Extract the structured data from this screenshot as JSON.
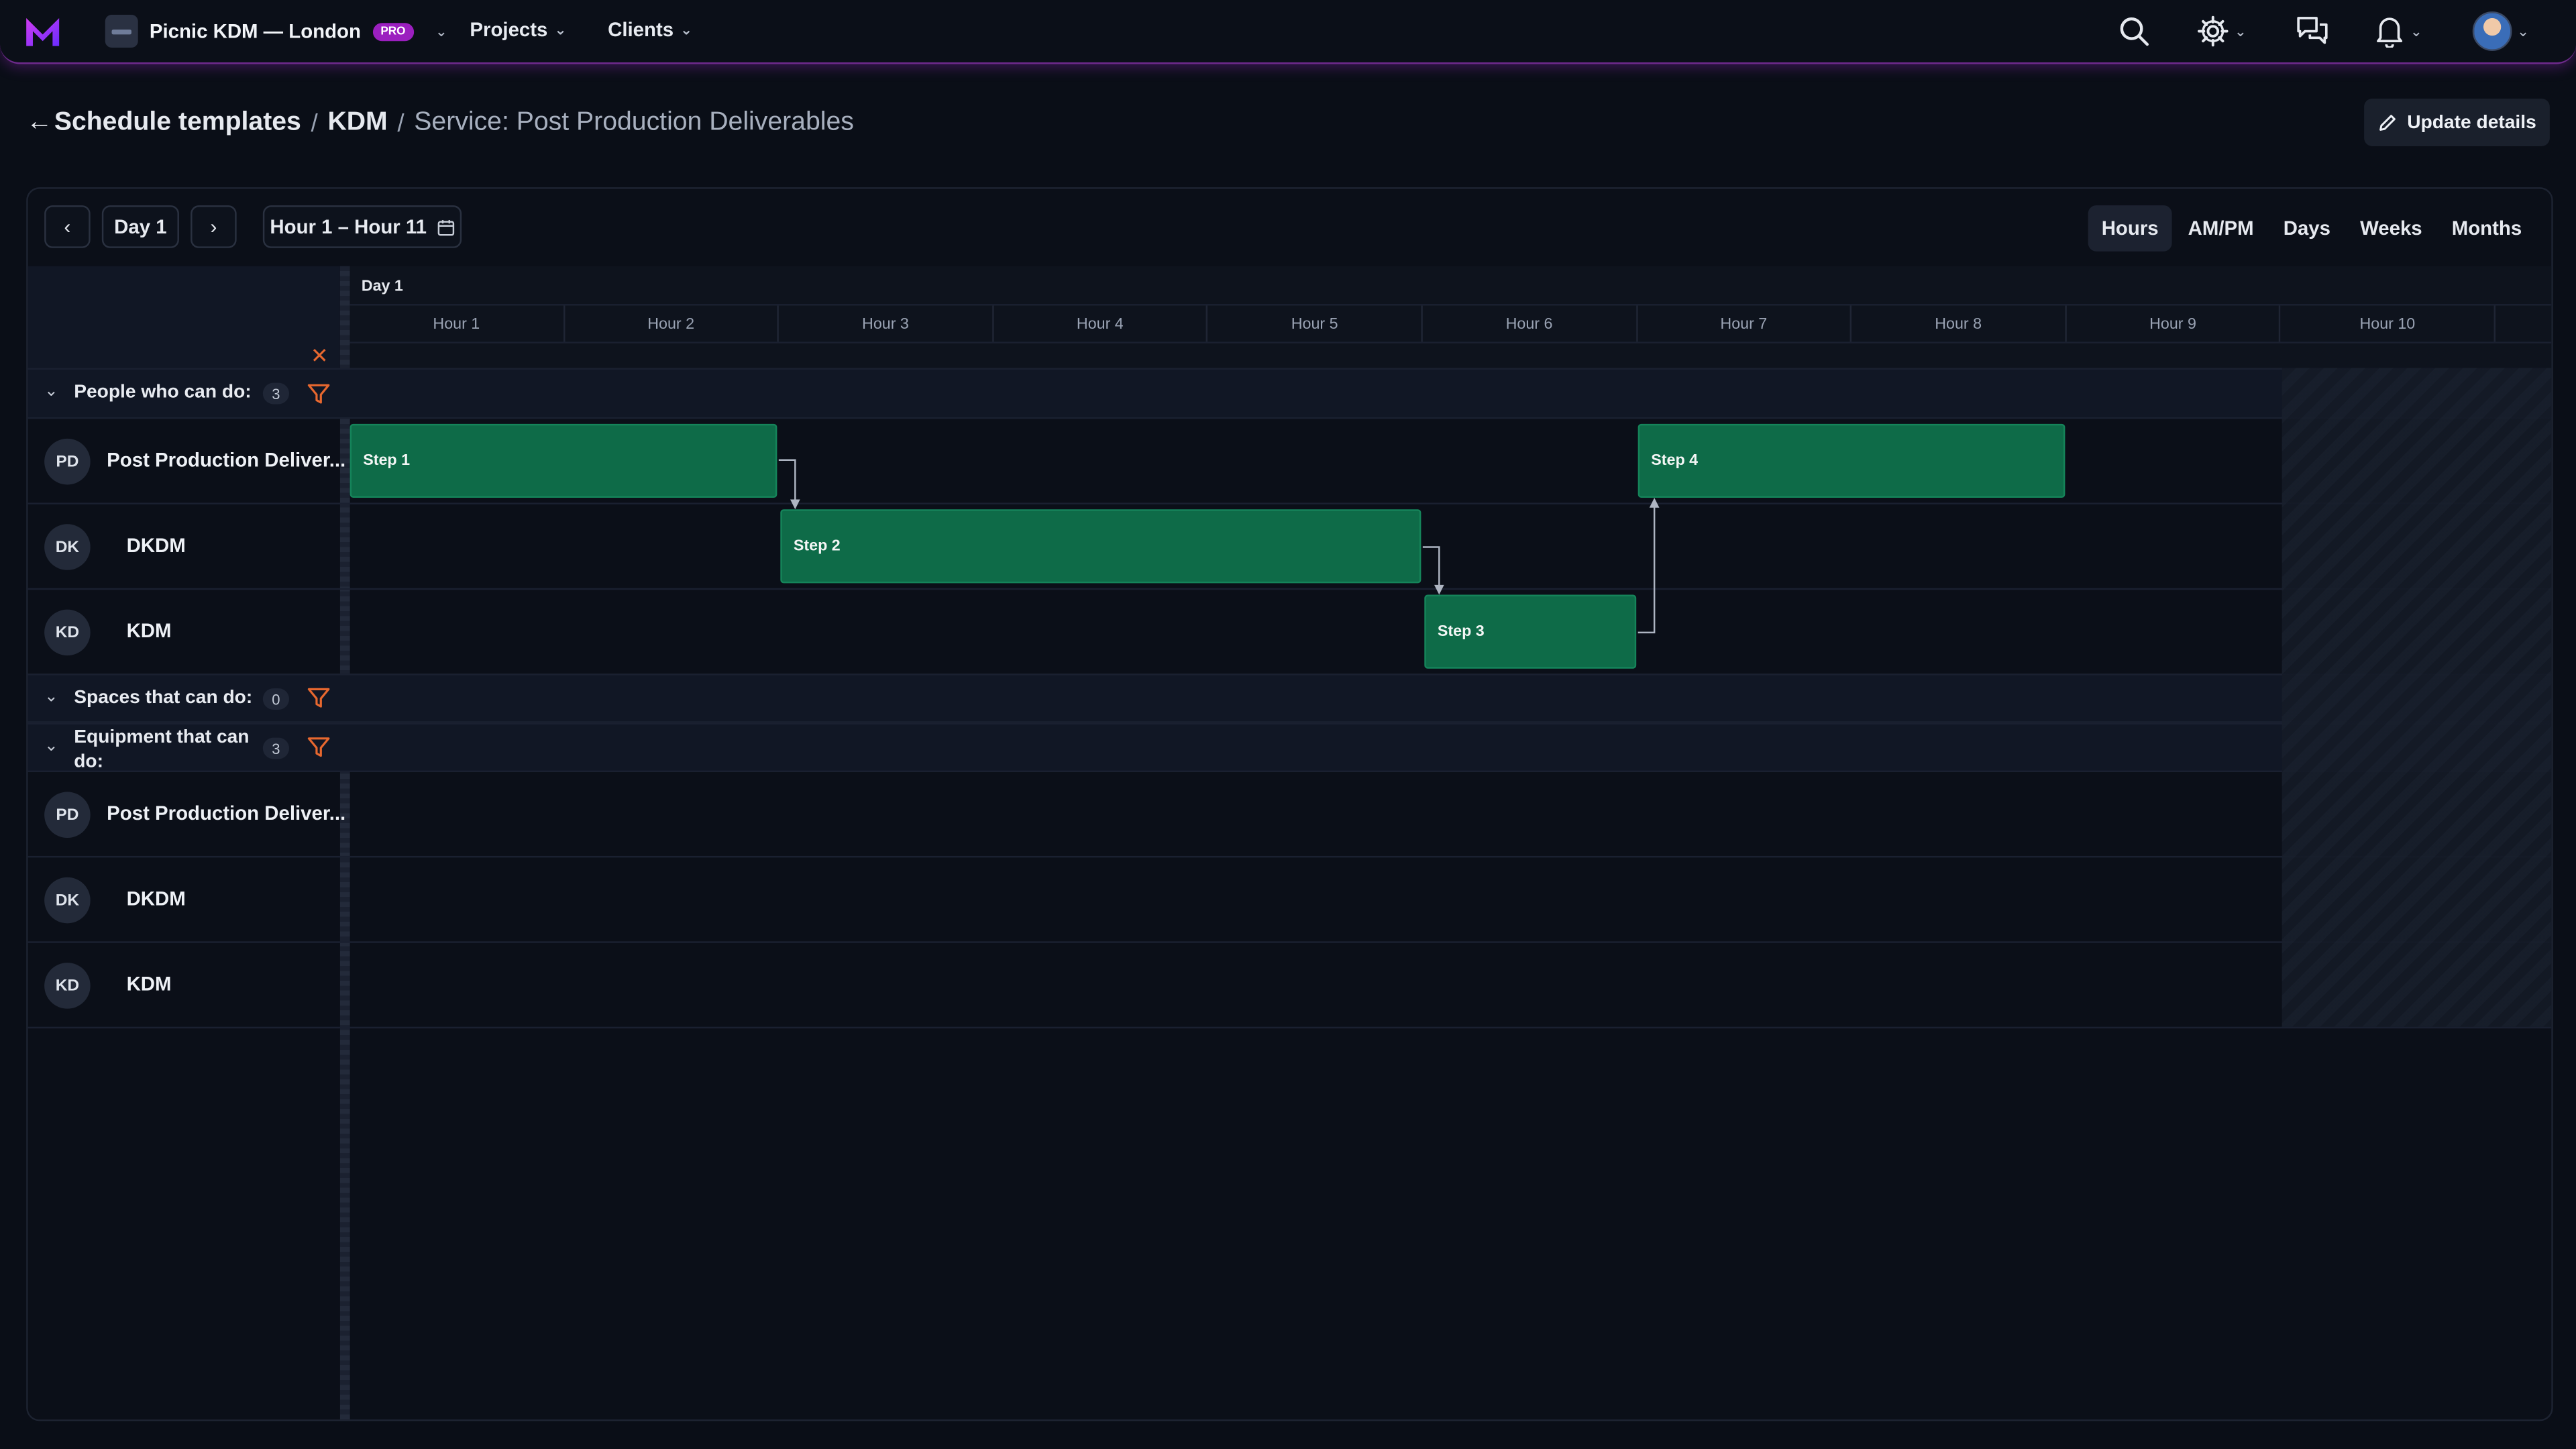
{
  "topbar": {
    "org_name": "Picnic KDM — London",
    "org_badge": "PRO",
    "nav": [
      {
        "label": "Projects"
      },
      {
        "label": "Clients"
      }
    ],
    "icons": [
      "search-icon",
      "gear-icon",
      "chat-icon",
      "bell-icon",
      "user-avatar"
    ]
  },
  "breadcrumb": {
    "back_label": "Schedule templates",
    "project": "KDM",
    "current": "Service: Post Production Deliverables"
  },
  "actions": {
    "update_label": "Update details"
  },
  "toolbar": {
    "day_label": "Day 1",
    "range_label": "Hour 1 – Hour 11",
    "views": [
      "Hours",
      "AM/PM",
      "Days",
      "Weeks",
      "Months"
    ],
    "active_view": "Hours"
  },
  "timeline": {
    "day": "Day 1",
    "hours": [
      "Hour 1",
      "Hour 2",
      "Hour 3",
      "Hour 4",
      "Hour 5",
      "Hour 6",
      "Hour 7",
      "Hour 8",
      "Hour 9",
      "Hour 10"
    ]
  },
  "groups": {
    "people": {
      "label": "People who can do:",
      "count": "3"
    },
    "spaces": {
      "label": "Spaces that can do:",
      "count": "0"
    },
    "equipment": {
      "label": "Equipment that can do:",
      "count": "3"
    }
  },
  "people": [
    {
      "initials": "PD",
      "name": "Post Production Deliver..."
    },
    {
      "initials": "DK",
      "name": "DKDM"
    },
    {
      "initials": "KD",
      "name": "KDM"
    }
  ],
  "equipment": [
    {
      "initials": "PD",
      "name": "Post Production Deliver..."
    },
    {
      "initials": "DK",
      "name": "DKDM"
    },
    {
      "initials": "KD",
      "name": "KDM"
    }
  ],
  "steps": [
    {
      "label": "Step 1",
      "row": 0
    },
    {
      "label": "Step 2",
      "row": 1
    },
    {
      "label": "Step 3",
      "row": 2
    },
    {
      "label": "Step 4",
      "row": 0
    }
  ],
  "colors": {
    "accent": "#9b1fbf",
    "bar": "#0e6b48",
    "filter": "#e8682f"
  }
}
